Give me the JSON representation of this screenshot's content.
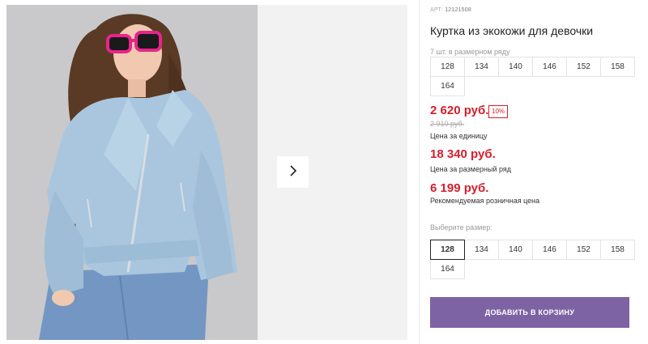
{
  "product": {
    "sku_label": "АРТ:",
    "sku": "12121508",
    "title": "Куртка из экокожи для девочки",
    "series_label": "7 шт. в размерном ряду",
    "series_sizes": [
      "128",
      "134",
      "140",
      "146",
      "152",
      "158",
      "164"
    ],
    "price": "2 620 руб.",
    "discount": "10%",
    "old_price": "2 910 руб.",
    "price_unit_caption": "Цена за единицу",
    "series_price": "18 340 руб.",
    "series_price_caption": "Цена за размерный ряд",
    "rrp_price": "6 199 руб.",
    "rrp_caption": "Рекомендуемая розничная цена",
    "choose_size_label": "Выберите размер:",
    "sizes": [
      "128",
      "134",
      "140",
      "146",
      "152",
      "158",
      "164"
    ],
    "selected_size": "128",
    "add_to_cart": "ДОБАВИТЬ В КОРЗИНУ"
  },
  "gallery": {
    "next_icon": "chevron-right-icon",
    "photo_subject": "girl-in-light-blue-jacket-and-pink-sunglasses"
  },
  "colors": {
    "price": "#d21f2e",
    "button": "#7d63a3",
    "jacket": "#a9c6de",
    "sunglasses": "#e8248c"
  }
}
